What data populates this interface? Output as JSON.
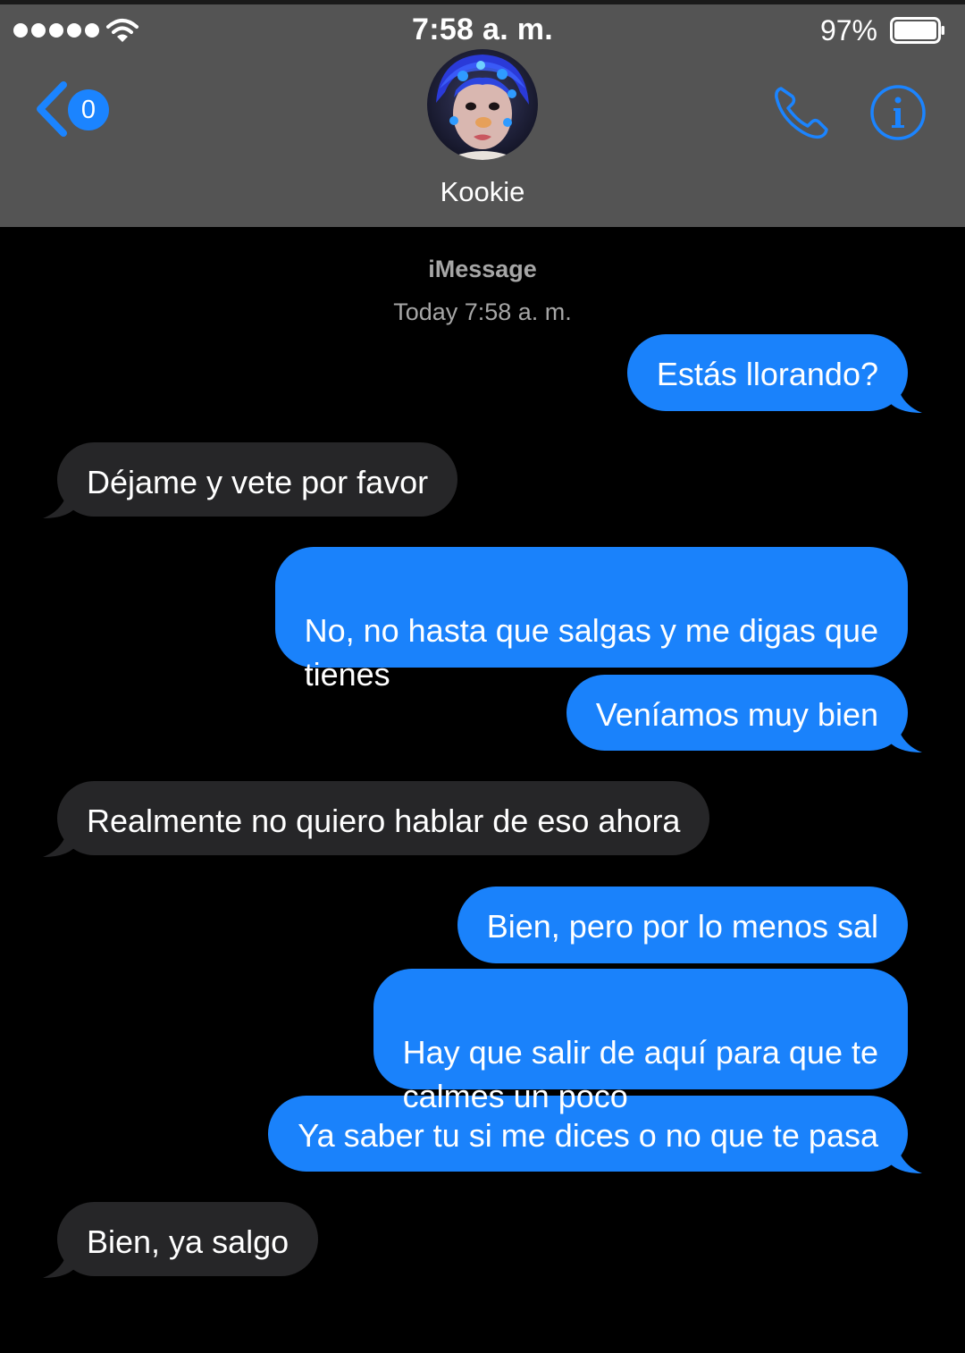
{
  "status_bar": {
    "time": "7:58 a. m.",
    "battery_percent": "97%",
    "signal_bars": 5
  },
  "nav": {
    "back_badge": "0",
    "contact_name": "Kookie",
    "icons": [
      "back-chevron-icon",
      "phone-icon",
      "info-icon"
    ]
  },
  "conversation": {
    "service": "iMessage",
    "timestamp": "Today 7:58 a. m.",
    "messages": [
      {
        "from": "me",
        "text": "Estás llorando?"
      },
      {
        "from": "contact",
        "text": "Déjame y vete por favor"
      },
      {
        "from": "me",
        "text": "No, no hasta que salgas y me digas que\ntienes"
      },
      {
        "from": "me",
        "text": "Veníamos muy bien"
      },
      {
        "from": "contact",
        "text": "Realmente no quiero hablar de eso ahora"
      },
      {
        "from": "me",
        "text": "Bien, pero por lo menos sal"
      },
      {
        "from": "me",
        "text": "Hay que salir de aquí para que te\ncalmes un poco"
      },
      {
        "from": "me",
        "text": "Ya saber tu si me dices o no que te pasa"
      },
      {
        "from": "contact",
        "text": "Bien, ya salgo"
      }
    ]
  },
  "colors": {
    "sent_bubble": "#1a82fb",
    "received_bubble": "#262628",
    "header_bg": "#545454",
    "accent": "#1b84ff",
    "meta_text": "#a6a6a6"
  }
}
